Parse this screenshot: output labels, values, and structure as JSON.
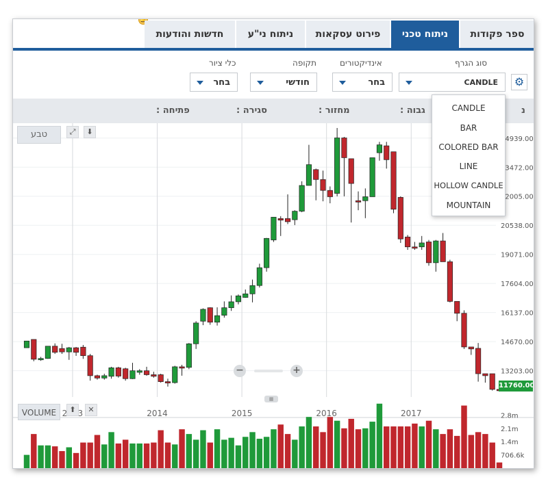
{
  "tabs": [
    {
      "label": "ספר פקודות",
      "active": false
    },
    {
      "label": "ניתוח טכני",
      "active": true
    },
    {
      "label": "פירוט עסקאות",
      "active": false
    },
    {
      "label": "ניתוח ני\"ע",
      "active": false
    },
    {
      "label": "חדשות והודעות",
      "active": false
    }
  ],
  "controls": {
    "chart_type_label": "סוג הגרף",
    "chart_type_value": "CANDLE",
    "indicators_label": "אינדיקטורים",
    "indicators_value": "בחר",
    "period_label": "תקופה",
    "period_value": "חודשי",
    "drawing_label": "כלי ציור",
    "drawing_value": "בחר"
  },
  "info_bar": {
    "open_label": "פתיחה :",
    "close_label": "סגירה :",
    "volume_label": "מחזור :",
    "high_label": "גבוה :",
    "low_label": "נ"
  },
  "dropdown": {
    "items": [
      "CANDLE",
      "BAR",
      "COLORED BAR",
      "LINE",
      "HOLLOW CANDLE",
      "MOUNTAIN"
    ]
  },
  "buttons": {
    "natural": "טבע",
    "volume": "VOLUME",
    "zoom_minus": "−",
    "zoom_plus": "+",
    "collapse": "⬇",
    "expand": "⤢",
    "volume_up": "⬆",
    "volume_close": "✕"
  },
  "last_price": "11760.00",
  "colors": {
    "accent": "#1f5d9c",
    "up": "#1f9a3a",
    "down": "#c0272d"
  },
  "chart_data": {
    "type": "candlestick",
    "price_axis_labels": [
      "24939.00",
      "23472.00",
      "22005.00",
      "20538.00",
      "19071.00",
      "17604.00",
      "16137.00",
      "14670.00",
      "13203.00"
    ],
    "ylim": [
      11980,
      25450
    ],
    "x_labels": [
      "2013",
      "2014",
      "2015",
      "2016",
      "2017"
    ],
    "volume_axis_labels": [
      "2.8m",
      "2.1m",
      "1.4m",
      "706.6k"
    ],
    "volume_ylim": [
      0,
      3500000
    ],
    "candles": [
      {
        "date": "2012-06",
        "o": 14360,
        "c": 14700,
        "h": 14700,
        "l": 14360,
        "v": 700000
      },
      {
        "date": "2012-07",
        "o": 14780,
        "c": 13780,
        "h": 14780,
        "l": 13680,
        "v": 1800000
      },
      {
        "date": "2012-08",
        "o": 13780,
        "c": 13820,
        "h": 13900,
        "l": 13700,
        "v": 1200000
      },
      {
        "date": "2012-09",
        "o": 13820,
        "c": 14440,
        "h": 14440,
        "l": 13800,
        "v": 1200000
      },
      {
        "date": "2012-10",
        "o": 14440,
        "c": 14130,
        "h": 14580,
        "l": 14050,
        "v": 1150000
      },
      {
        "date": "2012-11",
        "o": 14320,
        "c": 14150,
        "h": 14560,
        "l": 14050,
        "v": 900000
      },
      {
        "date": "2012-12",
        "o": 14150,
        "c": 14360,
        "h": 14400,
        "l": 13750,
        "v": 1100000
      },
      {
        "date": "2013-01",
        "o": 14360,
        "c": 14130,
        "h": 14400,
        "l": 13950,
        "v": 800000
      },
      {
        "date": "2013-02",
        "o": 14390,
        "c": 13960,
        "h": 14500,
        "l": 13800,
        "v": 1350000
      },
      {
        "date": "2013-03",
        "o": 13960,
        "c": 12950,
        "h": 14050,
        "l": 12700,
        "v": 1350000
      },
      {
        "date": "2013-04",
        "o": 12950,
        "c": 12830,
        "h": 13000,
        "l": 12750,
        "v": 1750000
      },
      {
        "date": "2013-05",
        "o": 12830,
        "c": 12950,
        "h": 13050,
        "l": 12750,
        "v": 1250000
      },
      {
        "date": "2013-06",
        "o": 12920,
        "c": 13350,
        "h": 13400,
        "l": 12800,
        "v": 1900000
      },
      {
        "date": "2013-07",
        "o": 13350,
        "c": 12930,
        "h": 13400,
        "l": 12850,
        "v": 1300000
      },
      {
        "date": "2013-08",
        "o": 13300,
        "c": 12800,
        "h": 13350,
        "l": 12700,
        "v": 1500000
      },
      {
        "date": "2013-09",
        "o": 12800,
        "c": 13200,
        "h": 13600,
        "l": 12780,
        "v": 1300000
      },
      {
        "date": "2013-10",
        "o": 13120,
        "c": 13200,
        "h": 13280,
        "l": 13000,
        "v": 1300000
      },
      {
        "date": "2013-11",
        "o": 13200,
        "c": 13000,
        "h": 13400,
        "l": 12950,
        "v": 1300000
      },
      {
        "date": "2013-12",
        "o": 13000,
        "c": 12920,
        "h": 13150,
        "l": 12850,
        "v": 1350000
      },
      {
        "date": "2014-01",
        "o": 13000,
        "c": 12650,
        "h": 13050,
        "l": 12600,
        "v": 2000000
      },
      {
        "date": "2014-02",
        "o": 12650,
        "c": 12620,
        "h": 12800,
        "l": 12400,
        "v": 1350000
      },
      {
        "date": "2014-03",
        "o": 12600,
        "c": 13400,
        "h": 13450,
        "l": 12550,
        "v": 1250000
      },
      {
        "date": "2014-04",
        "o": 13400,
        "c": 13370,
        "h": 13500,
        "l": 12950,
        "v": 2050000
      },
      {
        "date": "2014-05",
        "o": 13370,
        "c": 14560,
        "h": 14600,
        "l": 13280,
        "v": 1800000
      },
      {
        "date": "2014-06",
        "o": 14560,
        "c": 15610,
        "h": 15700,
        "l": 14300,
        "v": 1500000
      },
      {
        "date": "2014-07",
        "o": 15700,
        "c": 16300,
        "h": 16350,
        "l": 15500,
        "v": 2000000
      },
      {
        "date": "2014-08",
        "o": 16380,
        "c": 15650,
        "h": 16400,
        "l": 15520,
        "v": 1350000
      },
      {
        "date": "2014-09",
        "o": 15650,
        "c": 15980,
        "h": 16400,
        "l": 15480,
        "v": 2050000
      },
      {
        "date": "2014-10",
        "o": 16000,
        "c": 16380,
        "h": 16700,
        "l": 15880,
        "v": 1500000
      },
      {
        "date": "2014-11",
        "o": 16380,
        "c": 16680,
        "h": 17000,
        "l": 16220,
        "v": 1600000
      },
      {
        "date": "2014-12",
        "o": 16680,
        "c": 16980,
        "h": 17050,
        "l": 16550,
        "v": 1200000
      },
      {
        "date": "2015-01",
        "o": 16900,
        "c": 17080,
        "h": 17300,
        "l": 16880,
        "v": 1650000
      },
      {
        "date": "2015-02",
        "o": 17080,
        "c": 17500,
        "h": 17800,
        "l": 16650,
        "v": 1900000
      },
      {
        "date": "2015-03",
        "o": 17500,
        "c": 18400,
        "h": 18600,
        "l": 17400,
        "v": 1550000
      },
      {
        "date": "2015-04",
        "o": 18400,
        "c": 19880,
        "h": 19900,
        "l": 18200,
        "v": 1650000
      },
      {
        "date": "2015-05",
        "o": 19800,
        "c": 20950,
        "h": 20960,
        "l": 19700,
        "v": 2050000
      },
      {
        "date": "2015-06",
        "o": 20880,
        "c": 20800,
        "h": 21000,
        "l": 20000,
        "v": 2300000
      },
      {
        "date": "2015-07",
        "o": 20880,
        "c": 20720,
        "h": 22100,
        "l": 20600,
        "v": 1800000
      },
      {
        "date": "2015-08",
        "o": 20820,
        "c": 21250,
        "h": 21300,
        "l": 20550,
        "v": 1500000
      },
      {
        "date": "2015-09",
        "o": 21250,
        "c": 22550,
        "h": 22760,
        "l": 21200,
        "v": 2200000
      },
      {
        "date": "2015-10",
        "o": 22550,
        "c": 23600,
        "h": 24600,
        "l": 22700,
        "v": 2700000
      },
      {
        "date": "2015-11",
        "o": 23350,
        "c": 22850,
        "h": 23400,
        "l": 21800,
        "v": 2200000
      },
      {
        "date": "2015-12",
        "o": 22850,
        "c": 22300,
        "h": 23300,
        "l": 21750,
        "v": 1900000
      },
      {
        "date": "2016-01",
        "o": 22300,
        "c": 21980,
        "h": 22500,
        "l": 21650,
        "v": 2700000
      },
      {
        "date": "2016-02",
        "o": 22150,
        "c": 24950,
        "h": 25450,
        "l": 22000,
        "v": 2500000
      },
      {
        "date": "2016-03",
        "o": 24950,
        "c": 23950,
        "h": 25000,
        "l": 22000,
        "v": 2100000
      },
      {
        "date": "2016-04",
        "o": 23900,
        "c": 22650,
        "h": 23900,
        "l": 20680,
        "v": 2600000
      },
      {
        "date": "2016-05",
        "o": 21780,
        "c": 21750,
        "h": 22250,
        "l": 21300,
        "v": 2050000
      },
      {
        "date": "2016-06",
        "o": 21780,
        "c": 21980,
        "h": 22400,
        "l": 20900,
        "v": 2100000
      },
      {
        "date": "2016-07",
        "o": 21980,
        "c": 23950,
        "h": 23950,
        "l": 21980,
        "v": 2450000
      },
      {
        "date": "2016-08",
        "o": 24200,
        "c": 24600,
        "h": 24750,
        "l": 23800,
        "v": 3400000
      },
      {
        "date": "2016-09",
        "o": 24550,
        "c": 23850,
        "h": 24750,
        "l": 23400,
        "v": 2200000
      },
      {
        "date": "2016-10",
        "o": 24250,
        "c": 21350,
        "h": 24250,
        "l": 21150,
        "v": 2200000
      },
      {
        "date": "2016-11",
        "o": 21950,
        "c": 19850,
        "h": 22000,
        "l": 19650,
        "v": 2200000
      },
      {
        "date": "2016-12",
        "o": 19950,
        "c": 19450,
        "h": 20050,
        "l": 19300,
        "v": 2200000
      },
      {
        "date": "2017-01",
        "o": 19450,
        "c": 19400,
        "h": 19700,
        "l": 19300,
        "v": 2350000
      },
      {
        "date": "2017-02",
        "o": 19450,
        "c": 19650,
        "h": 20000,
        "l": 19300,
        "v": 2200000
      },
      {
        "date": "2017-03",
        "o": 19700,
        "c": 18650,
        "h": 19800,
        "l": 18500,
        "v": 2500000
      },
      {
        "date": "2017-04",
        "o": 18650,
        "c": 19750,
        "h": 19800,
        "l": 18200,
        "v": 2050000
      },
      {
        "date": "2017-05",
        "o": 19750,
        "c": 18700,
        "h": 20150,
        "l": 18700,
        "v": 1800000
      },
      {
        "date": "2017-06",
        "o": 18700,
        "c": 16700,
        "h": 18800,
        "l": 16650,
        "v": 2050000
      },
      {
        "date": "2017-07",
        "o": 16700,
        "c": 16100,
        "h": 16700,
        "l": 15700,
        "v": 1700000
      },
      {
        "date": "2017-08",
        "o": 16100,
        "c": 14400,
        "h": 16250,
        "l": 14300,
        "v": 3300000
      },
      {
        "date": "2017-09",
        "o": 14400,
        "c": 14300,
        "h": 14400,
        "l": 14000,
        "v": 1750000
      },
      {
        "date": "2017-10",
        "o": 14330,
        "c": 13050,
        "h": 14600,
        "l": 12650,
        "v": 1900000
      },
      {
        "date": "2017-11",
        "o": 13050,
        "c": 12950,
        "h": 13050,
        "l": 12600,
        "v": 1800000
      },
      {
        "date": "2017-12",
        "o": 13050,
        "c": 12260,
        "h": 13050,
        "l": 12200,
        "v": 1350000
      },
      {
        "date": "2018-01",
        "o": 12260,
        "c": 12240,
        "h": 12650,
        "l": 12200,
        "v": 300000
      }
    ]
  }
}
